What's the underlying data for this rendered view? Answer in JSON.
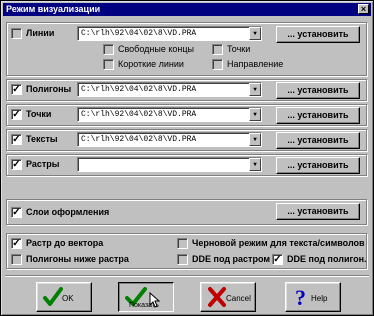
{
  "window": {
    "title": "Режим визуализации",
    "close_glyph": "×"
  },
  "install_label": "... установить",
  "lines": {
    "label": "Линии",
    "path": "C:\\rlh\\92\\04\\02\\8\\VD.PRA",
    "options": {
      "free_ends": "Свободные концы",
      "short_lines": "Короткие линии",
      "points": "Точки",
      "direction": "Направление"
    }
  },
  "rows": [
    {
      "label": "Полигоны",
      "checked": true,
      "path": "C:\\rlh\\92\\04\\02\\8\\VD.PRA"
    },
    {
      "label": "Точки",
      "checked": true,
      "path": "C:\\rlh\\92\\04\\02\\8\\VD.PRA"
    },
    {
      "label": "Тексты",
      "checked": true,
      "path": "C:\\rlh\\92\\04\\02\\8\\VD.PRA"
    },
    {
      "label": "Растры",
      "checked": true,
      "path": ""
    }
  ],
  "layout_layers": {
    "label": "Слои оформления",
    "checked": true
  },
  "options": {
    "raster_to_vector": "Растр до вектора",
    "polygons_below_raster": "Полигоны ниже растра",
    "draft_mode": "Черновой режим для текста/символов",
    "dde_under_raster": "DDE под растром",
    "dde_under_polygon": "DDE под полигон."
  },
  "check_glyph": "✓",
  "buttons": {
    "ok": "OK",
    "show": "Показать",
    "cancel": "Cancel",
    "help": "Help"
  },
  "colors": {
    "title_bar": "#000080",
    "face": "#c0c0c0",
    "ok_green": "#008000",
    "cancel_red": "#c00000",
    "help_blue": "#0000c0"
  },
  "icons": {
    "ok": "green-checkmark",
    "show": "green-checkmark",
    "cancel": "red-x",
    "help": "question-mark"
  }
}
